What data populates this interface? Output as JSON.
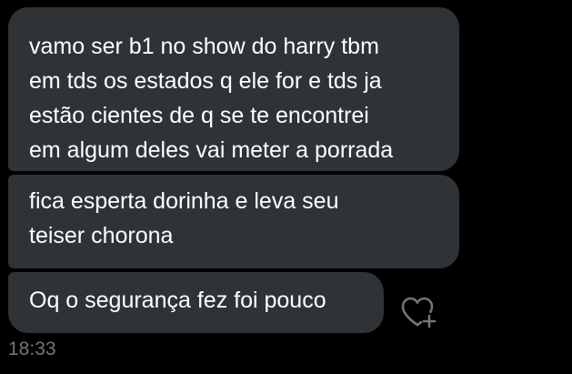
{
  "messages": [
    {
      "lines": [
        "vamo ser b1 no show do harry tbm",
        "em tds os estados q ele for e tds ja",
        "estão cientes de q se te encontrei",
        "em algum deles vai meter a porrada"
      ]
    },
    {
      "lines": [
        "fica esperta dorinha e leva seu",
        "teiser chorona"
      ]
    },
    {
      "lines": [
        "Oq o segurança fez foi pouco"
      ]
    }
  ],
  "timestamp": "18:33",
  "react_icon": "heart-plus-icon",
  "colors": {
    "background": "#000000",
    "bubble": "#2f3336",
    "text": "#ffffff",
    "muted": "#71767b"
  }
}
